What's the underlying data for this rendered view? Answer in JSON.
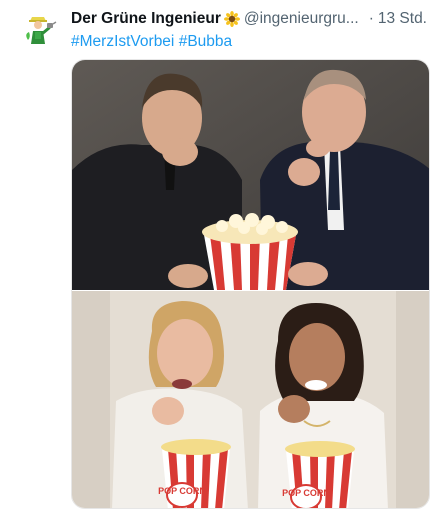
{
  "author": {
    "display_name": "Der Grüne Ingenieur",
    "handle": "@ingenieurgru...",
    "time_separator": "·",
    "time": "13 Std.",
    "avatar_icon": "gardener-avatar-icon",
    "badge_icon": "sunflower-icon"
  },
  "text": {
    "hashtags": [
      "#MerzIstVorbei",
      "#Bubba"
    ]
  },
  "media": {
    "popcorn_label": "POP CORN"
  },
  "colors": {
    "link": "#1d9bf0",
    "secondary_text": "#536471",
    "primary_text": "#0f1419"
  }
}
